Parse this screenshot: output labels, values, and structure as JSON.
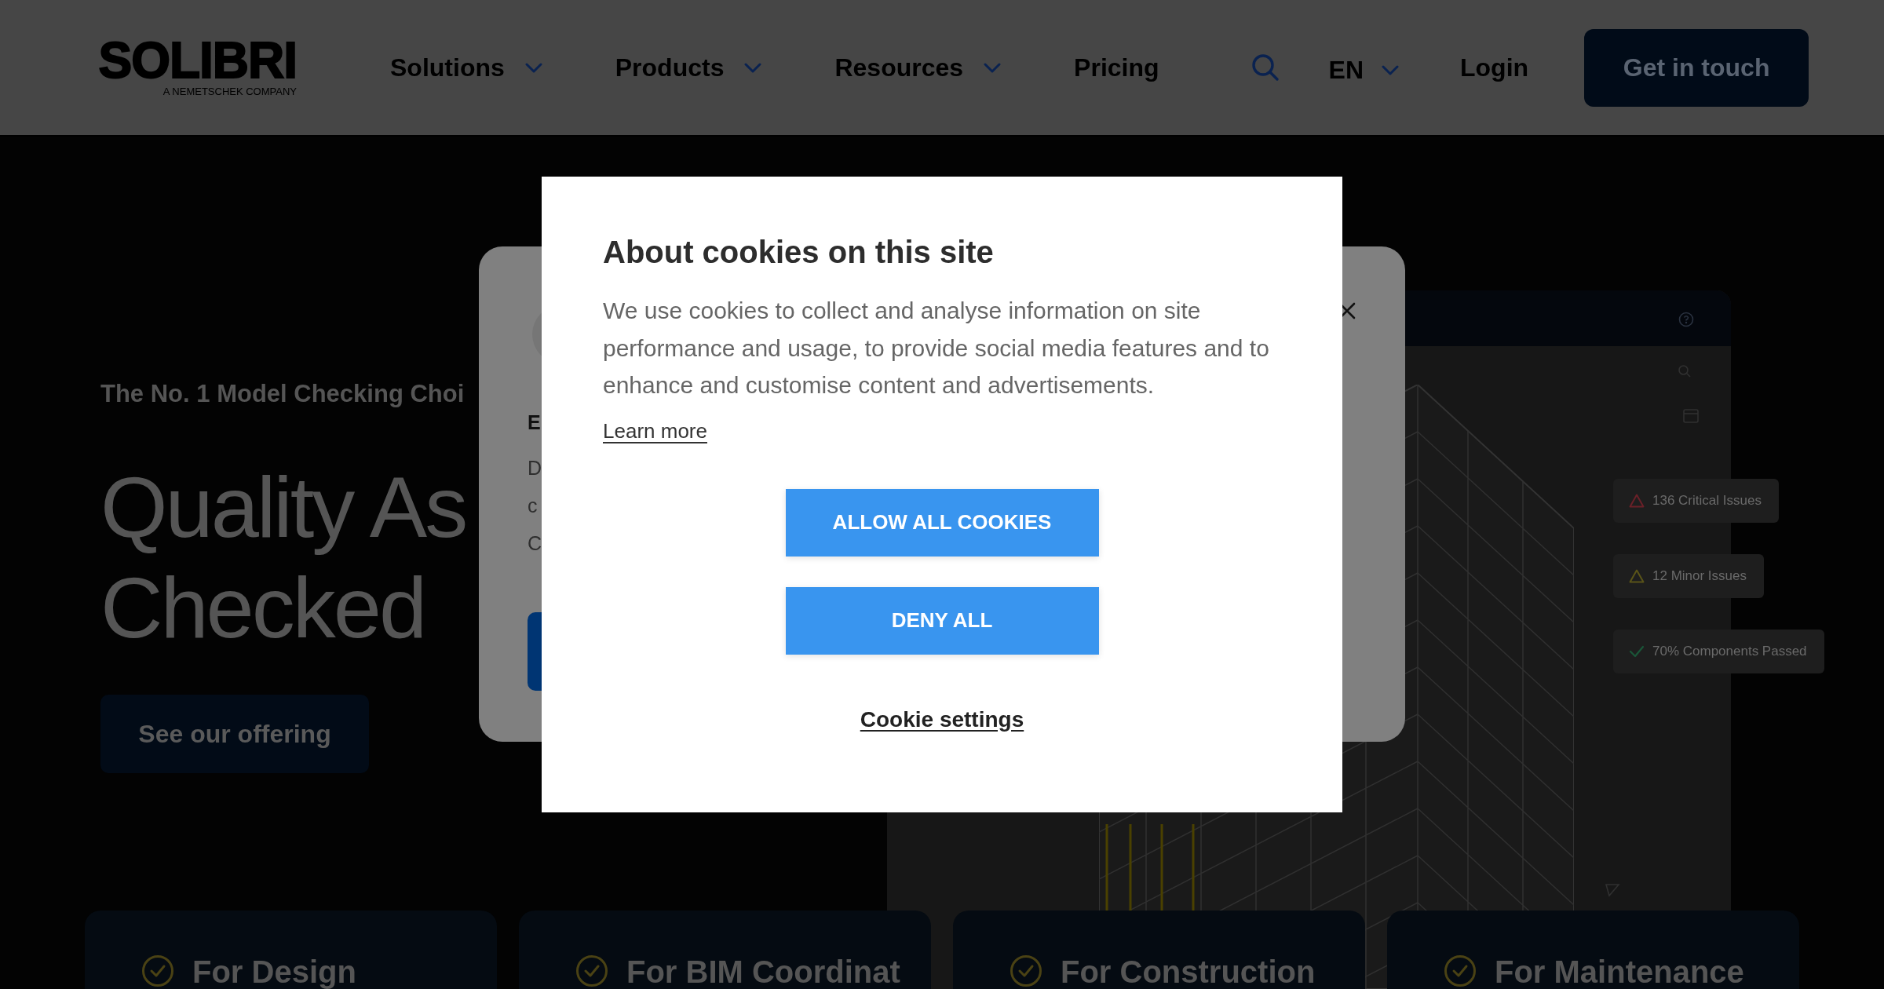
{
  "header": {
    "logo": "SOLIBRI",
    "logo_subtitle": "A NEMETSCHEK COMPANY",
    "nav": [
      {
        "label": "Solutions",
        "dropdown": true
      },
      {
        "label": "Products",
        "dropdown": true
      },
      {
        "label": "Resources",
        "dropdown": true
      },
      {
        "label": "Pricing",
        "dropdown": false
      }
    ],
    "language": "EN",
    "login": "Login",
    "cta": "Get in touch"
  },
  "hero": {
    "tagline": "The No. 1 Model Checking Choi",
    "headline": [
      "Quality As",
      "Checked"
    ],
    "button": "See our offering"
  },
  "product_image": {
    "badges": [
      {
        "kind": "critical",
        "label": "136 Critical Issues"
      },
      {
        "kind": "minor",
        "label": "12 Minor Issues"
      },
      {
        "kind": "passed",
        "label": "70% Components Passed"
      }
    ]
  },
  "feature_cards": [
    {
      "label": "For Design"
    },
    {
      "label": "For BIM Coordinat"
    },
    {
      "label": "For Construction"
    },
    {
      "label": "For Maintenance"
    }
  ],
  "background_dialog": {
    "heading": "E",
    "lines": [
      "D",
      "c",
      "C"
    ]
  },
  "cookie_dialog": {
    "title": "About cookies on this site",
    "text": "We use cookies to collect and analyse information on site performance and usage, to provide social media features and to enhance and customise content and advertisements.",
    "learn_more": "Learn more",
    "buttons": [
      {
        "label": "ALLOW ALL COOKIES"
      },
      {
        "label": "DENY ALL"
      }
    ],
    "settings_link": "Cookie settings"
  }
}
